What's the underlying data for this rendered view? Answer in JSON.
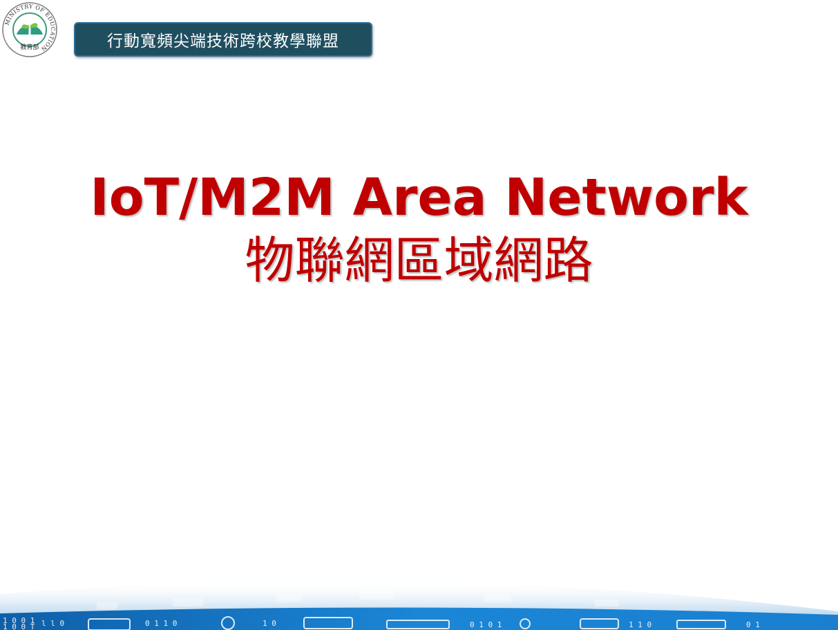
{
  "logo": {
    "icon": "ministry-of-education-seal",
    "ring_text": "MINISTRY OF EDUCATION",
    "center_text": "教育部"
  },
  "header": {
    "badge_text": "行動寬頻尖端技術跨校教學聯盟"
  },
  "slide": {
    "title_en": "IoT/M2M Area Network",
    "title_zh": "物聯網區域網路"
  },
  "colors": {
    "title": "#c00000",
    "badge_bg": "#1f4e5f",
    "badge_border": "#2f6f9a",
    "footer_blue": "#1a7fd0"
  },
  "footer": {
    "icon": "binary-circuit-banner"
  }
}
